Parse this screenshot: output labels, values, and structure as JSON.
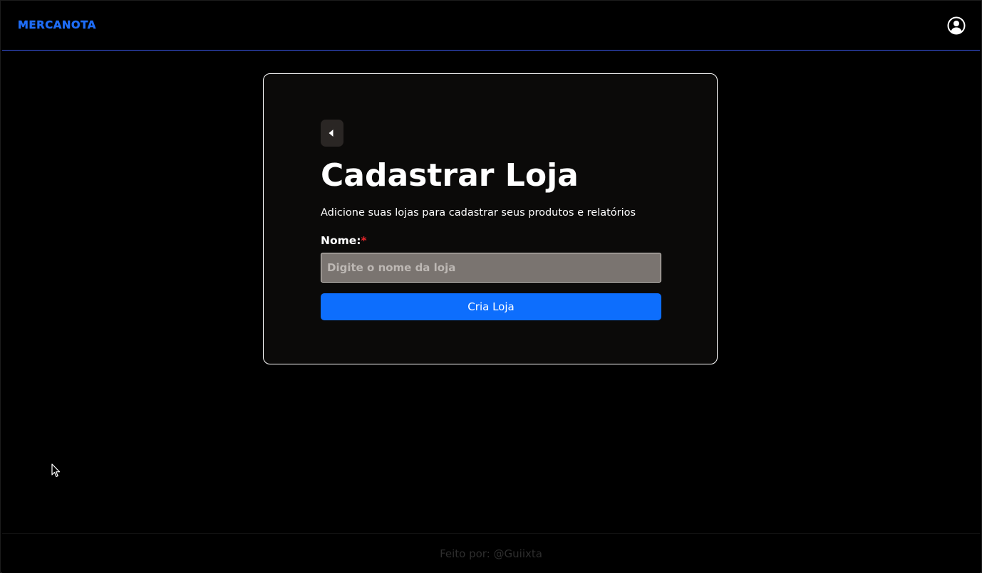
{
  "navbar": {
    "brand": "MERCANOTA",
    "profile_icon": "user-circle-icon",
    "accent_color": "#3a57e8"
  },
  "card": {
    "back_icon": "caret-left-icon",
    "title": "Cadastrar Loja",
    "subtitle": "Adicione suas lojas para cadastrar seus produtos e relatórios",
    "name_label": "Nome:",
    "required_mark": "*",
    "name_value": "",
    "name_placeholder": "Digite o nome da loja",
    "submit_label": "Cria Loja",
    "submit_color": "#0d6efd"
  },
  "footer": {
    "text": "Feito por: @Guiixta"
  }
}
